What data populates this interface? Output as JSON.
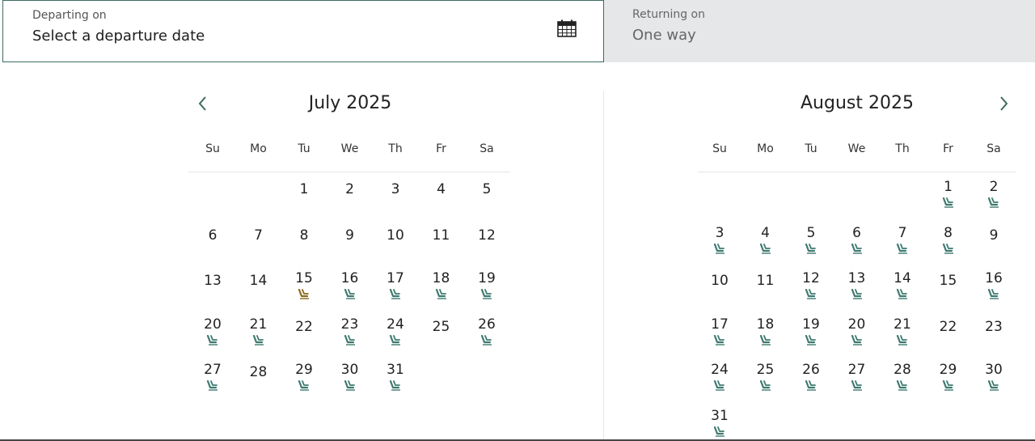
{
  "departing": {
    "label": "Departing on",
    "value": "Select a departure date",
    "icon": "calendar-icon"
  },
  "returning": {
    "label": "Returning on",
    "value": "One way"
  },
  "colors": {
    "accent": "#3d6b62",
    "seat_available": "#3f7a70",
    "seat_limited": "#8a6a1f",
    "return_bg": "#e6e7e9"
  },
  "weekdays": [
    "Su",
    "Mo",
    "Tu",
    "We",
    "Th",
    "Fr",
    "Sa"
  ],
  "months": [
    {
      "title": "July 2025",
      "first_weekday": 2,
      "days": 31,
      "seat_days": {
        "15": "limited",
        "16": "available",
        "17": "available",
        "18": "available",
        "19": "available",
        "20": "available",
        "21": "available",
        "23": "available",
        "24": "available",
        "26": "available",
        "27": "available",
        "29": "available",
        "30": "available",
        "31": "available"
      }
    },
    {
      "title": "August 2025",
      "first_weekday": 5,
      "days": 31,
      "seat_days": {
        "1": "available",
        "2": "available",
        "3": "available",
        "4": "available",
        "5": "available",
        "6": "available",
        "7": "available",
        "8": "available",
        "12": "available",
        "13": "available",
        "14": "available",
        "16": "available",
        "17": "available",
        "18": "available",
        "19": "available",
        "20": "available",
        "21": "available",
        "24": "available",
        "25": "available",
        "26": "available",
        "27": "available",
        "28": "available",
        "29": "available",
        "30": "available",
        "31": "available"
      }
    }
  ]
}
